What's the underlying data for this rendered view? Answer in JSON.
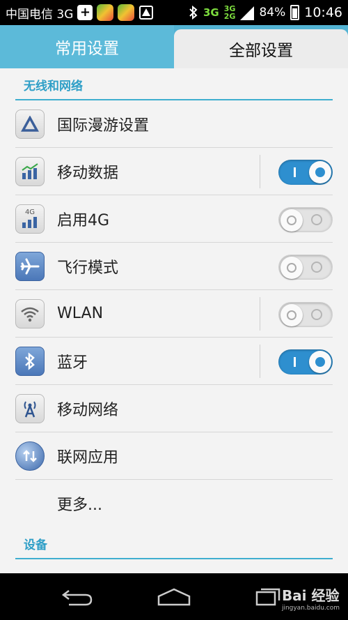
{
  "status_bar": {
    "carrier": "中国电信 3G",
    "network_main": "3G",
    "network_sub_top": "3G",
    "network_sub_bottom": "2G",
    "battery": "84%",
    "time": "10:46"
  },
  "tabs": [
    {
      "label": "常用设置",
      "active": false
    },
    {
      "label": "全部设置",
      "active": true
    }
  ],
  "sections": [
    {
      "header": "无线和网络"
    },
    {
      "header": "设备"
    }
  ],
  "items": [
    {
      "label": "国际漫游设置",
      "icon": "triangle-icon"
    },
    {
      "label": "移动数据",
      "icon": "mobile-data-icon",
      "toggle": "on"
    },
    {
      "label": "启用4G",
      "icon": "4g-icon",
      "icon_text": "4G",
      "toggle": "off"
    },
    {
      "label": "飞行模式",
      "icon": "airplane-icon",
      "toggle": "off"
    },
    {
      "label": "WLAN",
      "icon": "wifi-icon",
      "toggle": "off"
    },
    {
      "label": "蓝牙",
      "icon": "bluetooth-icon",
      "toggle": "on"
    },
    {
      "label": "移动网络",
      "icon": "antenna-icon"
    },
    {
      "label": "联网应用",
      "icon": "globe-icon"
    },
    {
      "label": "更多..."
    }
  ],
  "watermark": {
    "brand": "Bai 经验",
    "url": "jingyan.baidu.com"
  },
  "colors": {
    "accent": "#3eaecf",
    "toggle_on": "#2e8fcf",
    "tab_bar": "#53b3d3"
  }
}
